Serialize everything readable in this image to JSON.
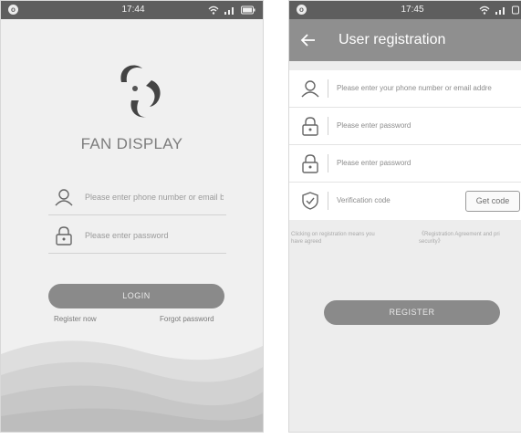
{
  "login_screen": {
    "status_bar": {
      "time": "17:44"
    },
    "brand": "FAN DISPLAY",
    "phone_input": {
      "placeholder": "Please enter phone number or email b"
    },
    "password_input": {
      "placeholder": "Please enter password"
    },
    "login_button": "LOGIN",
    "register_link": "Register now",
    "forgot_link": "Forgot password",
    "icons": [
      "status-dot-icon",
      "wifi-icon",
      "signal-icon",
      "battery-icon",
      "fan-logo-icon",
      "user-icon",
      "lock-icon"
    ]
  },
  "registration_screen": {
    "status_bar": {
      "time": "17:45"
    },
    "title": "User registration",
    "fields": {
      "account": "Please enter your phone number or email addre",
      "password": "Please enter password",
      "confirm_password": "Please enter password",
      "verification": "Verification code"
    },
    "get_code_button": "Get code",
    "agreement_prefix_line1": "Clicking on registration means you",
    "agreement_prefix_line2": "have agreed",
    "agreement_link_line1": "《Registration Agreement and pri",
    "agreement_link_line2": "security》",
    "register_button": "REGISTER",
    "icons": [
      "back-arrow-icon",
      "user-icon",
      "lock-icon",
      "shield-icon"
    ]
  },
  "colors": {
    "status_bar": "#5e5e5e",
    "app_bar": "#8f8f8f",
    "button": "#8a8a8a",
    "background": "#f0f0f0"
  }
}
